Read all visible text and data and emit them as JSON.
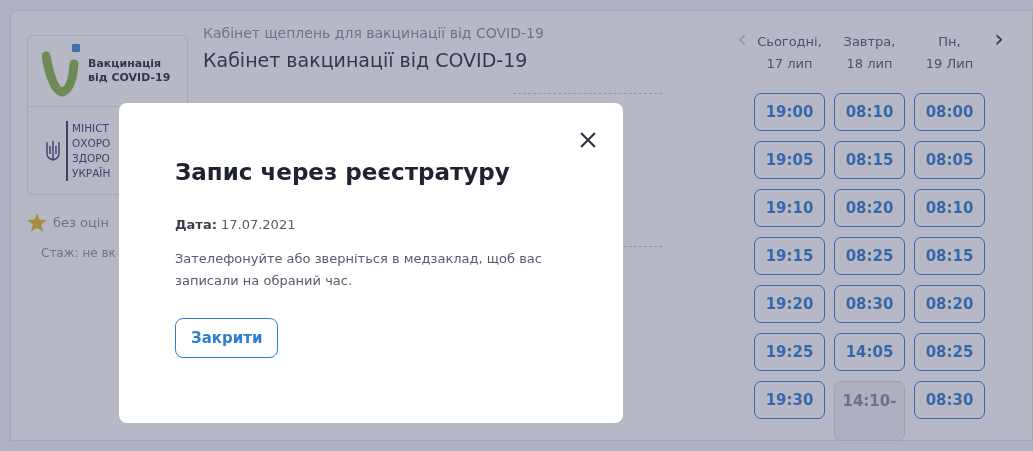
{
  "clinic": {
    "logo_text": [
      "Вакцинація",
      "від COVID-19"
    ],
    "ministry_lines": [
      "МІНІСТ",
      "ОХОРО",
      "ЗДОРО",
      "УКРАЇН"
    ],
    "rating": "без оцін",
    "experience": "Стаж: не вк",
    "subtitle": "Кабінет щеплень для вакцинації від COVID-19",
    "title": "Кабінет вакцинації від COVID-19"
  },
  "schedule": {
    "prev": {
      "label": "‹",
      "disabled": true
    },
    "next": {
      "label": "›",
      "disabled": false
    },
    "days": [
      {
        "day": "Сьогодні,",
        "date": "17 лип",
        "slots": [
          {
            "time": "19:00",
            "disabled": false
          },
          {
            "time": "19:05",
            "disabled": false
          },
          {
            "time": "19:10",
            "disabled": false
          },
          {
            "time": "19:15",
            "disabled": false
          },
          {
            "time": "19:20",
            "disabled": false
          },
          {
            "time": "19:25",
            "disabled": false
          },
          {
            "time": "19:30",
            "disabled": false
          }
        ]
      },
      {
        "day": "Завтра,",
        "date": "18 лип",
        "slots": [
          {
            "time": "08:10",
            "disabled": false
          },
          {
            "time": "08:15",
            "disabled": false
          },
          {
            "time": "08:20",
            "disabled": false
          },
          {
            "time": "08:25",
            "disabled": false
          },
          {
            "time": "08:30",
            "disabled": false
          },
          {
            "time": "14:05",
            "disabled": false
          },
          {
            "time": "14:10-",
            "disabled": true
          }
        ]
      },
      {
        "day": "Пн,",
        "date": "19 Лип",
        "slots": [
          {
            "time": "08:00",
            "disabled": false
          },
          {
            "time": "08:05",
            "disabled": false
          },
          {
            "time": "08:10",
            "disabled": false
          },
          {
            "time": "08:15",
            "disabled": false
          },
          {
            "time": "08:20",
            "disabled": false
          },
          {
            "time": "08:25",
            "disabled": false
          },
          {
            "time": "08:30",
            "disabled": false
          }
        ]
      }
    ]
  },
  "modal": {
    "title": "Запис через реєстратуру",
    "date_label": "**Дата:** 17.07.2021",
    "message": "Зателефонуйте або зверніться в медзаклад, щоб вас записали на обраний час.",
    "close_button": "Закрити"
  }
}
